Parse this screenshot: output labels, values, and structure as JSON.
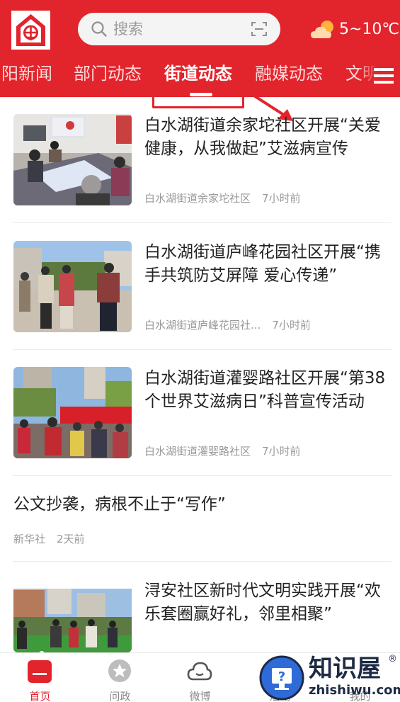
{
  "header": {
    "search_placeholder": "搜索",
    "weather_text": "5~10℃",
    "accent_color": "#e2242c"
  },
  "tabs": [
    {
      "label": "阳新闻"
    },
    {
      "label": "部门动态"
    },
    {
      "label": "街道动态",
      "active": true
    },
    {
      "label": "融媒动态"
    },
    {
      "label": "文明"
    }
  ],
  "feed": [
    {
      "title": "白水湖街道余家坨社区开展“关爱健康，从我做起”艾滋病宣传",
      "source": "白水湖街道余家坨社区",
      "time": "7小时前",
      "thumbnail": "meeting-photo"
    },
    {
      "title": "白水湖街道庐峰花园社区开展“携手共筑防艾屏障 爱心传递”",
      "source": "白水湖街道庐峰花园社...",
      "time": "7小时前",
      "thumbnail": "outdoor-crowd-photo"
    },
    {
      "title": "白水湖街道灌婴路社区开展“第38个世界艾滋病日”科普宣传活动",
      "source": "白水湖街道灌婴路社区",
      "time": "7小时前",
      "thumbnail": "booth-event-photo"
    },
    {
      "title": "公文抄袭，病根不止于“写作”",
      "source": "新华社",
      "time": "2天前"
    },
    {
      "title": "浔安社区新时代文明实践开展“欢乐套圈赢好礼，邻里相聚”",
      "thumbnail": "ring-toss-photo"
    }
  ],
  "bottom_nav": [
    {
      "label": "首页",
      "icon": "home-icon",
      "active": true
    },
    {
      "label": "问政",
      "icon": "star-chat-icon"
    },
    {
      "label": "微博",
      "icon": "cloud-icon"
    },
    {
      "label": "活动",
      "icon": "activity-icon"
    },
    {
      "label": "我的",
      "icon": "user-icon"
    }
  ],
  "watermark": {
    "title": "知识屋",
    "subtitle": "zhishiwu.com",
    "reg_mark": "®"
  }
}
